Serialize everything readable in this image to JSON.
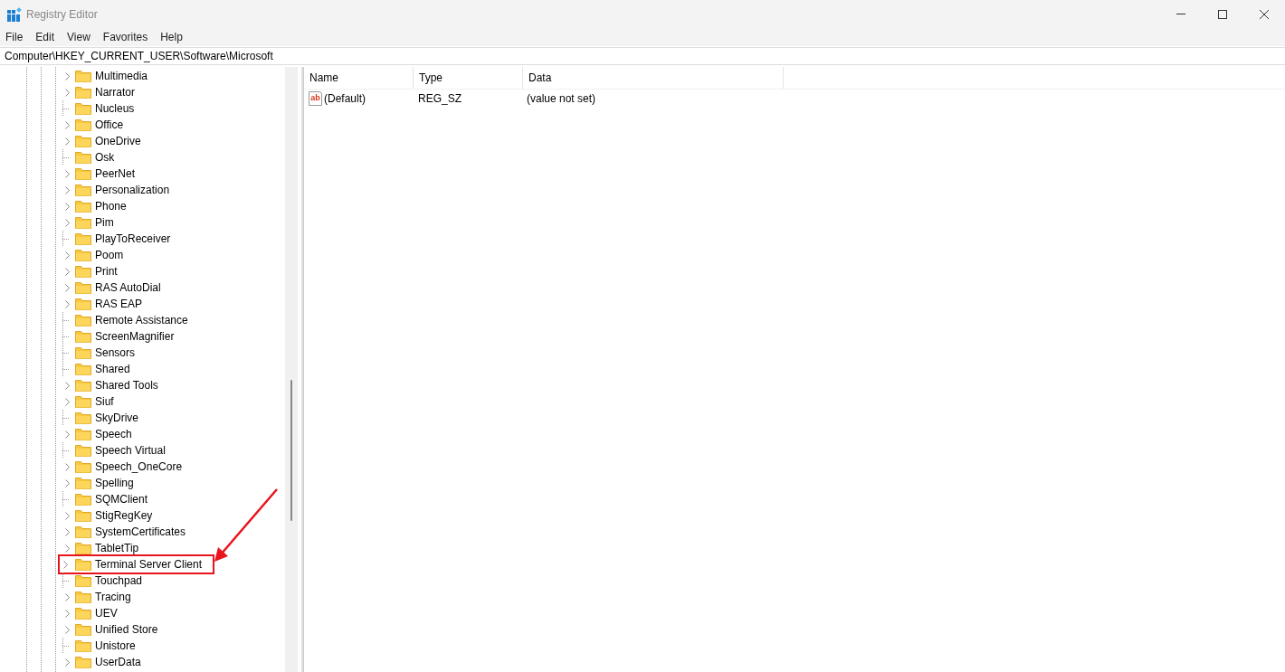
{
  "window": {
    "title": "Registry Editor"
  },
  "menu": [
    "File",
    "Edit",
    "View",
    "Favorites",
    "Help"
  ],
  "address": "Computer\\HKEY_CURRENT_USER\\Software\\Microsoft",
  "tree": {
    "items": [
      {
        "label": "Multimedia",
        "expandable": true,
        "highlighted": false
      },
      {
        "label": "Narrator",
        "expandable": true,
        "highlighted": false
      },
      {
        "label": "Nucleus",
        "expandable": false,
        "highlighted": false
      },
      {
        "label": "Office",
        "expandable": true,
        "highlighted": false
      },
      {
        "label": "OneDrive",
        "expandable": true,
        "highlighted": false
      },
      {
        "label": "Osk",
        "expandable": false,
        "highlighted": false
      },
      {
        "label": "PeerNet",
        "expandable": true,
        "highlighted": false
      },
      {
        "label": "Personalization",
        "expandable": true,
        "highlighted": false
      },
      {
        "label": "Phone",
        "expandable": true,
        "highlighted": false
      },
      {
        "label": "Pim",
        "expandable": true,
        "highlighted": false
      },
      {
        "label": "PlayToReceiver",
        "expandable": false,
        "highlighted": false
      },
      {
        "label": "Poom",
        "expandable": true,
        "highlighted": false
      },
      {
        "label": "Print",
        "expandable": true,
        "highlighted": false
      },
      {
        "label": "RAS AutoDial",
        "expandable": true,
        "highlighted": false
      },
      {
        "label": "RAS EAP",
        "expandable": true,
        "highlighted": false
      },
      {
        "label": "Remote Assistance",
        "expandable": false,
        "highlighted": false
      },
      {
        "label": "ScreenMagnifier",
        "expandable": false,
        "highlighted": false
      },
      {
        "label": "Sensors",
        "expandable": false,
        "highlighted": false
      },
      {
        "label": "Shared",
        "expandable": false,
        "highlighted": false
      },
      {
        "label": "Shared Tools",
        "expandable": true,
        "highlighted": false
      },
      {
        "label": "Siuf",
        "expandable": true,
        "highlighted": false
      },
      {
        "label": "SkyDrive",
        "expandable": false,
        "highlighted": false
      },
      {
        "label": "Speech",
        "expandable": true,
        "highlighted": false
      },
      {
        "label": "Speech Virtual",
        "expandable": false,
        "highlighted": false
      },
      {
        "label": "Speech_OneCore",
        "expandable": true,
        "highlighted": false
      },
      {
        "label": "Spelling",
        "expandable": true,
        "highlighted": false
      },
      {
        "label": "SQMClient",
        "expandable": false,
        "highlighted": false
      },
      {
        "label": "StigRegKey",
        "expandable": true,
        "highlighted": false
      },
      {
        "label": "SystemCertificates",
        "expandable": true,
        "highlighted": false
      },
      {
        "label": "TabletTip",
        "expandable": true,
        "highlighted": false
      },
      {
        "label": "Terminal Server Client",
        "expandable": true,
        "highlighted": true
      },
      {
        "label": "Touchpad",
        "expandable": false,
        "highlighted": false
      },
      {
        "label": "Tracing",
        "expandable": true,
        "highlighted": false
      },
      {
        "label": "UEV",
        "expandable": true,
        "highlighted": false
      },
      {
        "label": "Unified Store",
        "expandable": true,
        "highlighted": false
      },
      {
        "label": "Unistore",
        "expandable": false,
        "highlighted": false
      },
      {
        "label": "UserData",
        "expandable": true,
        "highlighted": false
      }
    ]
  },
  "values": {
    "columns": [
      "Name",
      "Type",
      "Data"
    ],
    "rows": [
      {
        "icon_text": "ab",
        "name": "(Default)",
        "type": "REG_SZ",
        "data": "(value not set)"
      }
    ]
  }
}
